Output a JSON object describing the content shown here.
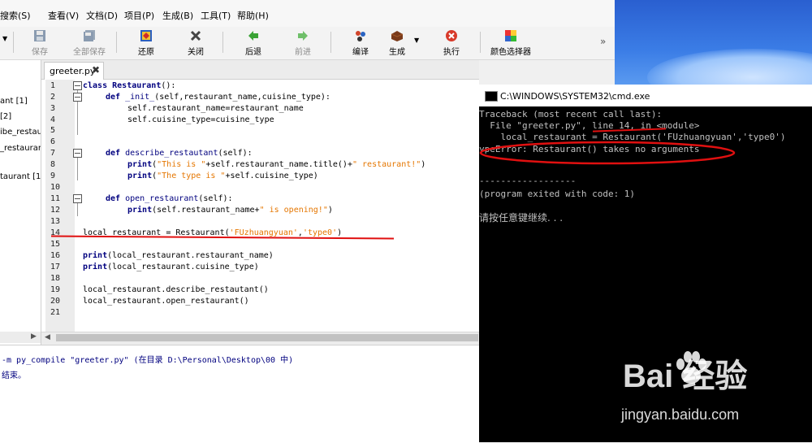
{
  "menu": [
    "搜索(S)",
    "查看(V)",
    "文档(D)",
    "项目(P)",
    "生成(B)",
    "工具(T)",
    "帮助(H)"
  ],
  "toolbar": {
    "save": "保存",
    "save_all": "全部保存",
    "revert": "还原",
    "close": "关闭",
    "back": "后退",
    "forward": "前进",
    "compile": "编译",
    "build": "生成",
    "execute": "执行",
    "color_picker": "颜色选择器",
    "overflow": "»"
  },
  "symbols": [
    "ant [1]",
    "[2]",
    "ibe_restau",
    "_restauran",
    "taurant [1"
  ],
  "tab": {
    "label": "greeter.py",
    "close": "✖"
  },
  "editor": {
    "line_numbers": [
      "1",
      "2",
      "3",
      "4",
      "5",
      "6",
      "7",
      "8",
      "9",
      "10",
      "11",
      "12",
      "13",
      "14",
      "15",
      "16",
      "17",
      "18",
      "19",
      "20",
      "21"
    ],
    "lines": {
      "l1_kw": "class",
      "l1_name": " Restaurant",
      "l1_rest": "():",
      "l2_kw": "def",
      "l2_name": " _init_",
      "l2_rest": "(self,restaurant_name,cuisine_type):",
      "l3": "self.restaurant_name=restaurant_name",
      "l4": "self.cuisine_type=cuisine_type",
      "l7_kw": "def",
      "l7_name": " describe_restautant",
      "l7_rest": "(self):",
      "l8_kw": "print",
      "l8_a": "(",
      "l8_s1": "\"This is \"",
      "l8_b": "+self.restaurant_name.title()+",
      "l8_s2": "\" restaurant!\"",
      "l8_c": ")",
      "l9_kw": "print",
      "l9_a": "(",
      "l9_s1": "\"The type is \"",
      "l9_b": "+self.cuisine_type)",
      "l11_kw": "def",
      "l11_name": " open_restaurant",
      "l11_rest": "(self):",
      "l12_kw": "print",
      "l12_a": "(self.restaurant_name+",
      "l12_s1": "\" is opening!\"",
      "l12_b": ")",
      "l14_a": "local_restaurant = Restaurant(",
      "l14_s1": "'FUzhuangyuan'",
      "l14_b": ",",
      "l14_s2": "'type0'",
      "l14_c": ")",
      "l16_kw": "print",
      "l16_a": "(local_restaurant.restaurant_name)",
      "l17_kw": "print",
      "l17_a": "(local_restaurant.cuisine_type)",
      "l19": "local_restaurant.describe_restautant()",
      "l20": "local_restaurant.open_restaurant()"
    }
  },
  "output": {
    "line1": "-m py_compile \"greeter.py\" (在目录 D:\\Personal\\Desktop\\00 中)",
    "line2": "结束。"
  },
  "cmd": {
    "title": "C:\\WINDOWS\\SYSTEM32\\cmd.exe",
    "traceback": "Traceback (most recent call last):",
    "file_line": "  File \"greeter.py\", line 14, in <module>",
    "code_line": "    local_restaurant = Restaurant('FUzhuangyuan','type0')",
    "error": "ypeError: Restaurant() takes no arguments",
    "dashes": "------------------",
    "exit": "(program exited with code: 1)",
    "prompt": "请按任意键继续. . ."
  },
  "watermark": {
    "brand": "Bai 经验",
    "url": "jingyan.baidu.com"
  },
  "colors": {
    "annotation": "#e01010",
    "keyword": "#00007f",
    "string": "#e57600"
  }
}
